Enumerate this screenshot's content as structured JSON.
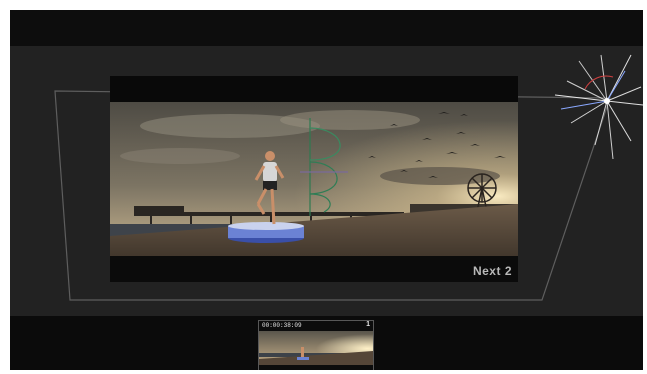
{
  "viewer": {
    "overlay_label": "Next 2",
    "colors": {
      "sky_top": "#6f6a5e",
      "sky_glow": "#e8d4a8",
      "sand": "#5a4a3a",
      "sea": "#3a4048",
      "guide": "#3a8a60",
      "star_blue": "#8aa8ff",
      "star_red": "#d04040"
    }
  },
  "filmstrip": {
    "timecode": "00:00:38:09",
    "clip_number": "1"
  },
  "icons": [
    "lens-flare-handle-icon",
    "bezier-guide-icon"
  ]
}
